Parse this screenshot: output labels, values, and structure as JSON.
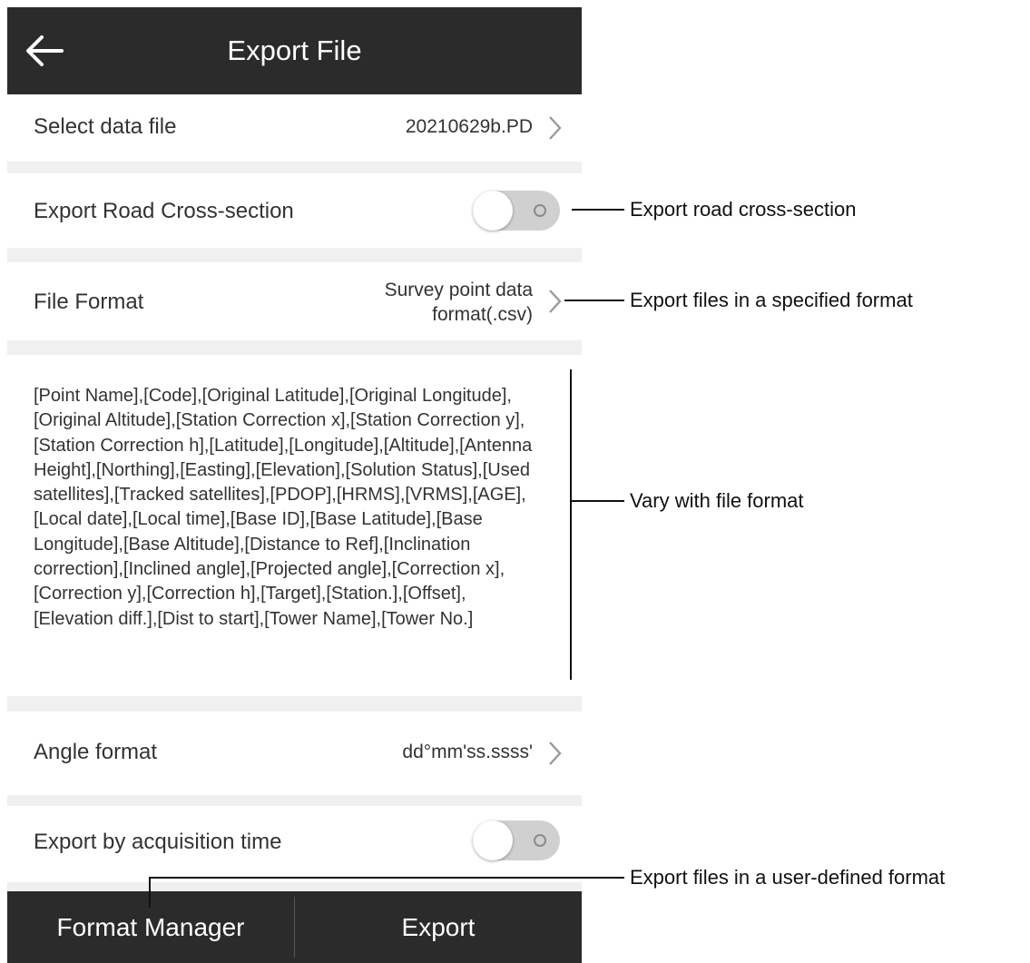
{
  "header": {
    "title": "Export File",
    "back_icon": "arrow-left-icon"
  },
  "rows": {
    "data_file": {
      "label": "Select data file",
      "value": "20210629b.PD"
    },
    "road_cross_section": {
      "label": "Export Road Cross-section",
      "toggle_on": false
    },
    "file_format": {
      "label": "File Format",
      "value_line1": "Survey point data",
      "value_line2": "format(.csv)"
    },
    "angle_format": {
      "label": "Angle format",
      "value": "dd°mm'ss.ssss'"
    },
    "acquisition_time": {
      "label": "Export by acquisition time",
      "toggle_on": false
    }
  },
  "format_fields": "[Point Name],[Code],[Original Latitude],[Original Longitude],[Original Altitude],[Station Correction x],[Station Correction y],[Station Correction h],[Latitude],[Longitude],[Altitude],[Antenna Height],[Northing],[Easting],[Elevation],[Solution Status],[Used satellites],[Tracked satellites],[PDOP],[HRMS],[VRMS],[AGE],[Local date],[Local time],[Base ID],[Base Latitude],[Base Longitude],[Base Altitude],[Distance to Ref],[Inclination correction],[Inclined angle],[Projected angle],[Correction x],[Correction y],[Correction h],[Target],[Station.],[Offset],[Elevation diff.],[Dist to start],[Tower Name],[Tower No.]",
  "bottom_bar": {
    "format_manager": "Format Manager",
    "export": "Export"
  },
  "callouts": {
    "road_cross_section": "Export road cross-section",
    "file_format": "Export files in a specified format",
    "fields": "Vary with file format",
    "format_manager": "Export files in a user-defined format"
  },
  "colors": {
    "bar": "#2b2b2b",
    "background": "#f0f0f0",
    "row": "#ffffff",
    "toggle_off": "#d0d0d0"
  }
}
